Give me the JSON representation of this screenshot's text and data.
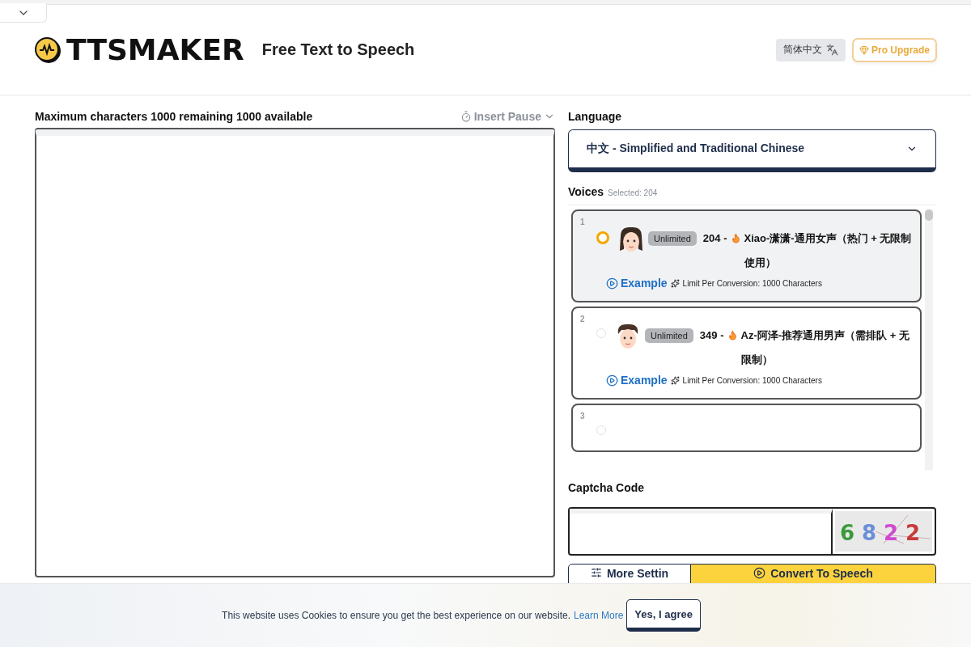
{
  "header": {
    "logo": "TTSMAKER",
    "tagline": "Free Text to Speech",
    "language_button": "简体中文",
    "upgrade_button": "Pro Upgrade"
  },
  "editor": {
    "counter": "Maximum characters 1000 remaining 1000 available",
    "insert_pause": "Insert Pause"
  },
  "language": {
    "label": "Language",
    "value": "中文 - Simplified and Traditional Chinese"
  },
  "voices": {
    "label": "Voices",
    "selected_note": "Selected: 204",
    "items": [
      {
        "number": "1",
        "selected": true,
        "kind": "girl",
        "badge": "Unlimited",
        "name": "204 -",
        "title": "Xiao-潇潇-通用女声（热门 + 无限制使用）",
        "example": "Example",
        "limit": "Limit Per Conversion: 1000 Characters"
      },
      {
        "number": "2",
        "selected": false,
        "kind": "boy",
        "badge": "Unlimited",
        "name": "349 -",
        "title": "Az-阿泽-推荐通用男声（需排队 + 无限制）",
        "example": "Example",
        "limit": "Limit Per Conversion: 1000 Characters"
      },
      {
        "number": "3",
        "selected": false
      }
    ]
  },
  "captcha": {
    "label": "Captcha Code",
    "image_digits": [
      {
        "text": "6",
        "color": "#3a9a3a"
      },
      {
        "text": "8",
        "color": "#6a8fd8"
      },
      {
        "text": "2",
        "color": "#d04ad0"
      },
      {
        "text": "2",
        "color": "#c83a3a"
      }
    ]
  },
  "actions": {
    "settings_button": "More Settin",
    "convert_button": "Convert To Speech"
  },
  "cookie_banner": {
    "message": "This website uses Cookies to ensure you get the best experience on our website.",
    "link": "Learn More",
    "accept_button": "Yes, I agree"
  }
}
